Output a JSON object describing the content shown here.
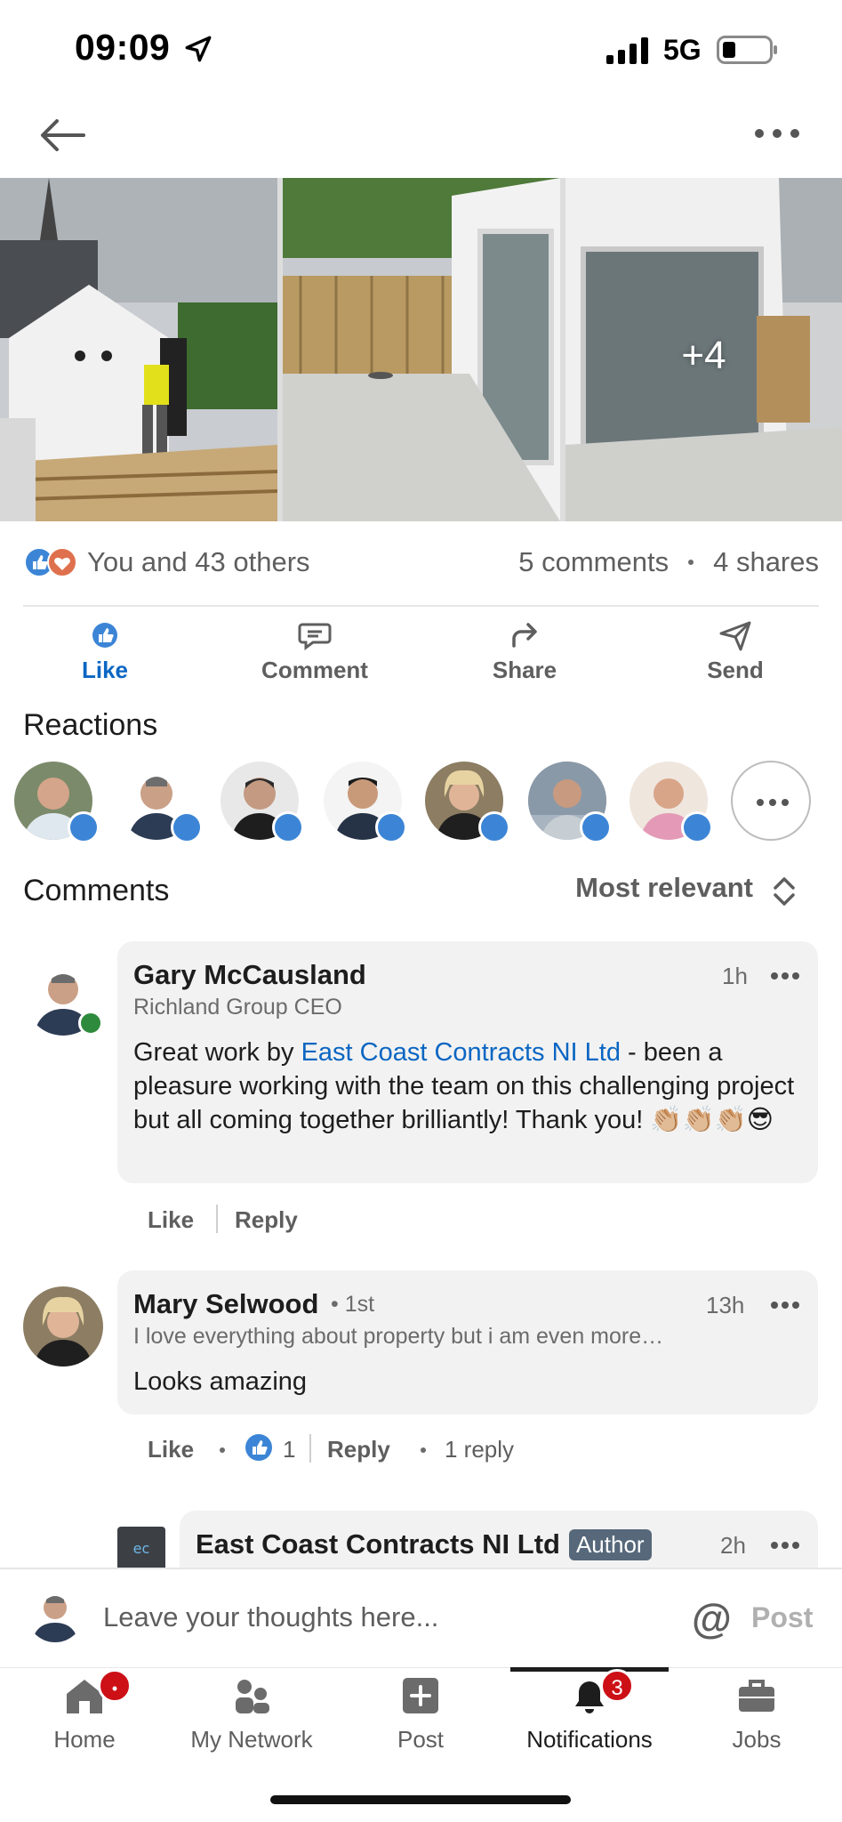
{
  "status_bar": {
    "time": "09:09",
    "network": "5G"
  },
  "nav": {
    "back_icon": "back-arrow-icon",
    "more_icon": "more-icon"
  },
  "photos": {
    "more_count": "+4"
  },
  "social": {
    "likes_text": "You and 43 others",
    "comments_count": "5 comments",
    "shares_count": "4 shares"
  },
  "actions": [
    {
      "label": "Like",
      "icon": "like-icon",
      "active": true
    },
    {
      "label": "Comment",
      "icon": "comment-icon"
    },
    {
      "label": "Share",
      "icon": "share-icon"
    },
    {
      "label": "Send",
      "icon": "send-icon"
    }
  ],
  "reactions": {
    "title": "Reactions"
  },
  "comments": {
    "title": "Comments",
    "sort_label": "Most relevant",
    "items": [
      {
        "name": "Gary McCausland",
        "headline": "Richland Group CEO",
        "time": "1h",
        "text_before": "Great work by ",
        "mention": "East Coast Contracts NI Ltd",
        "text_after": " - been a pleasure working with the team on this challenging project but all coming together brilliantly! Thank you! 👏🏼👏🏼👏🏼😎",
        "like_label": "Like",
        "reply_label": "Reply"
      },
      {
        "name": "Mary Selwood",
        "degree": "• 1st",
        "headline": "I love everything about property but i am even more…",
        "time": "13h",
        "text": "Looks amazing",
        "like_label": "Like",
        "like_count": "1",
        "reply_label": "Reply",
        "reply_count": "1 reply"
      },
      {
        "name": "East Coast Contracts NI Ltd",
        "author_badge": "Author",
        "time": "2h"
      }
    ]
  },
  "compose": {
    "placeholder": "Leave your thoughts here...",
    "at": "@",
    "post_label": "Post"
  },
  "tabs": [
    {
      "label": "Home",
      "icon": "home-icon",
      "badge": "•"
    },
    {
      "label": "My Network",
      "icon": "network-icon"
    },
    {
      "label": "Post",
      "icon": "post-icon"
    },
    {
      "label": "Notifications",
      "icon": "bell-icon",
      "badge": "3",
      "active": true
    },
    {
      "label": "Jobs",
      "icon": "briefcase-icon"
    }
  ],
  "colors": {
    "accent": "#0a66c2",
    "like_blue": "#3c85d6",
    "badge_red": "#cc1016",
    "online_green": "#2e8b3d"
  }
}
